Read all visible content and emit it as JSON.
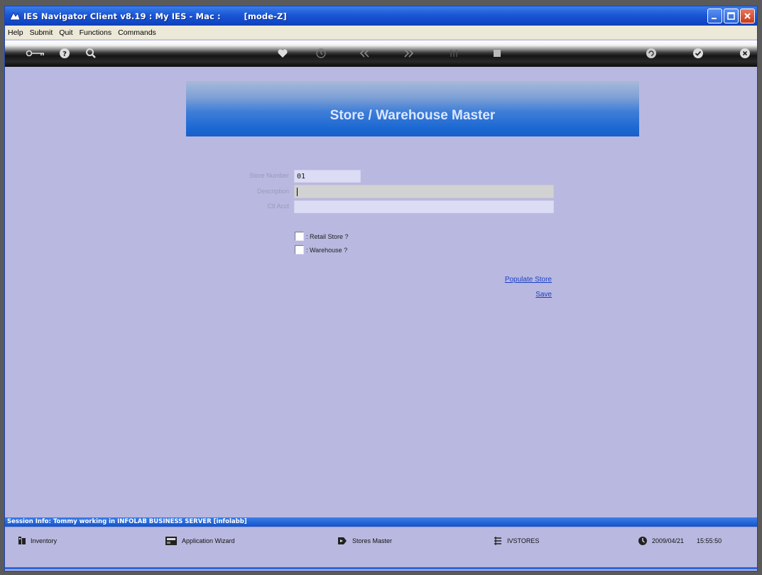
{
  "window": {
    "title": "IES Navigator Client v8.19 : My IES - Mac :        [mode-Z]"
  },
  "menu": {
    "items": [
      "Help",
      "Submit",
      "Quit",
      "Functions",
      "Commands"
    ]
  },
  "page": {
    "banner_title": "Store / Warehouse Master"
  },
  "form": {
    "store_number_label": "Store Number",
    "store_number_value": "01",
    "description_label": "Description",
    "description_value": "",
    "ctl_acct_label": "Ctl Acct",
    "ctl_acct_value": "",
    "retail_store_label": ": Retail Store ?",
    "retail_store_checked": false,
    "warehouse_label": ": Warehouse ?",
    "warehouse_checked": false
  },
  "actions": {
    "populate_store": "Populate Store",
    "save": "Save"
  },
  "status": {
    "session_info": "Session Info: Tommy working in INFOLAB BUSINESS SERVER  [infolabb]",
    "module": "Inventory",
    "wizard": "Application Wizard",
    "screen": "Stores Master",
    "table": "IVSTORES",
    "date": "2009/04/21",
    "time": "15:55:50"
  },
  "colors": {
    "content_bg": "#b9b8e0",
    "titlebar": "#1a56d6",
    "banner": "#1c68d3",
    "link": "#1a3fc4"
  }
}
